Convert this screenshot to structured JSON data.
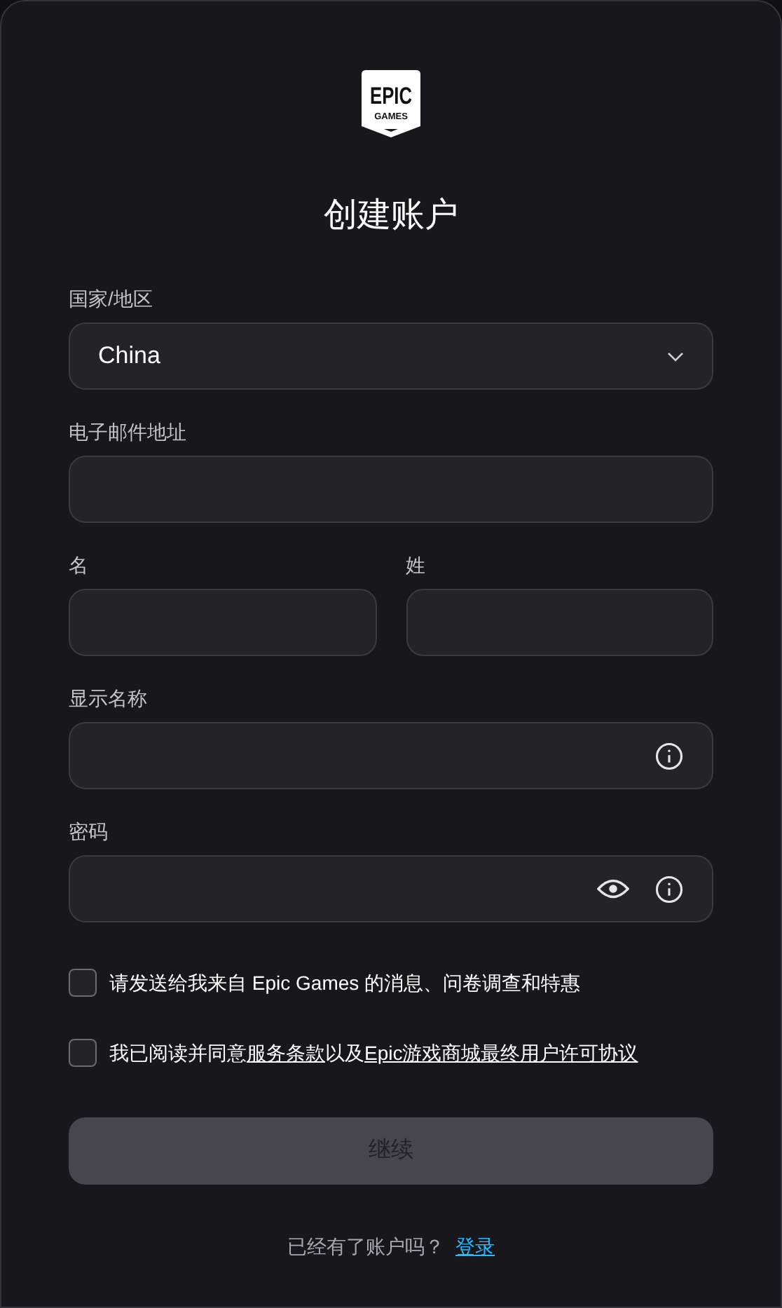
{
  "logo": {
    "line1": "EPIC",
    "line2": "GAMES"
  },
  "title": "创建账户",
  "field_rows": [
    {
      "fields": [
        {
          "label": "国家/地区",
          "kind": "select",
          "value": "China"
        }
      ]
    },
    {
      "fields": [
        {
          "label": "电子邮件地址",
          "kind": "text"
        }
      ]
    },
    {
      "fields": [
        {
          "label": "名",
          "kind": "text"
        },
        {
          "label": "姓",
          "kind": "text"
        }
      ]
    },
    {
      "fields": [
        {
          "label": "显示名称",
          "kind": "text_info"
        }
      ]
    },
    {
      "fields": [
        {
          "label": "密码",
          "kind": "password"
        }
      ]
    }
  ],
  "checkboxes": [
    {
      "checked": false,
      "segments": [
        {
          "kind": "text",
          "text": "请发送给我来自 Epic Games 的消息、问卷调查和特惠"
        }
      ]
    },
    {
      "checked": false,
      "segments": [
        {
          "kind": "text",
          "text": "我已阅读并同意"
        },
        {
          "kind": "link",
          "text": "服务条款"
        },
        {
          "kind": "text",
          "text": "以及"
        },
        {
          "kind": "link",
          "text": "Epic游戏商城最终用户许可协议"
        }
      ]
    }
  ],
  "submit": {
    "label": "继续",
    "disabled": true
  },
  "footer": {
    "text": "已经有了账户吗？",
    "link": "登录"
  }
}
